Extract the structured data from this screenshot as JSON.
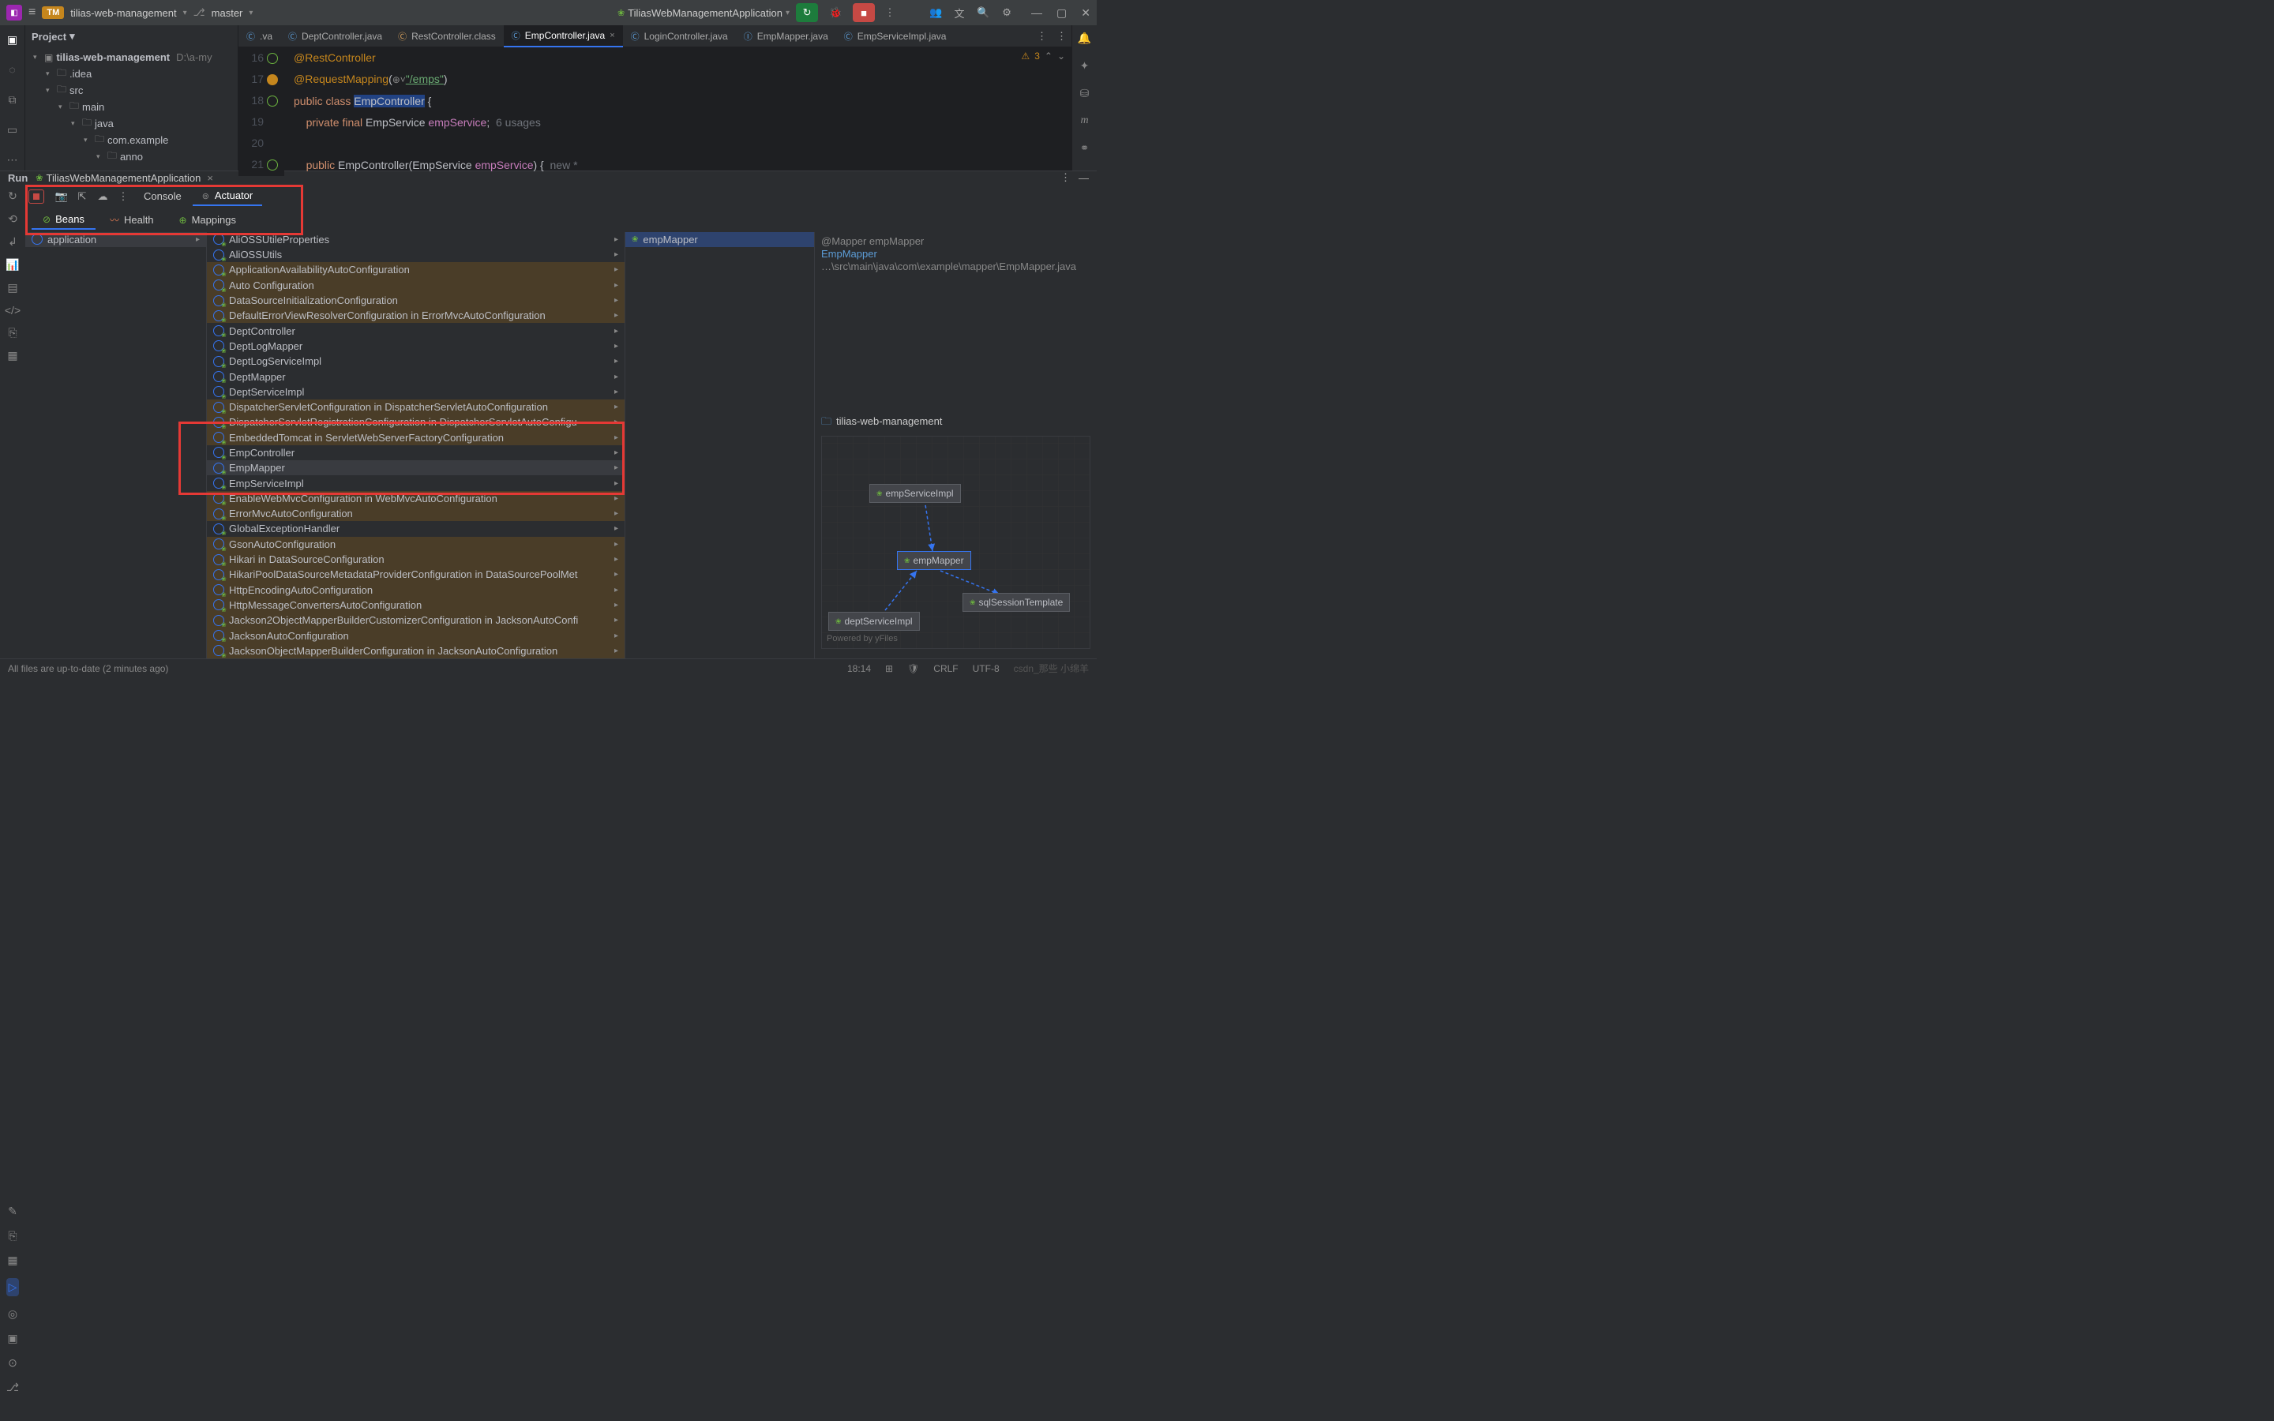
{
  "titlebar": {
    "project": "tilias-web-management",
    "proj_badge": "TM",
    "branch": "master",
    "run_config": "TiliasWebManagementApplication"
  },
  "project_tree": {
    "title": "Project",
    "root": "tilias-web-management",
    "root_path": "D:\\a-my",
    "nodes": [
      {
        "indent": 1,
        "label": ".idea"
      },
      {
        "indent": 1,
        "label": "src"
      },
      {
        "indent": 2,
        "label": "main"
      },
      {
        "indent": 3,
        "label": "java"
      },
      {
        "indent": 4,
        "label": "com.example"
      },
      {
        "indent": 5,
        "label": "anno"
      }
    ]
  },
  "editor_tabs": [
    {
      "label": ".va",
      "type": "java"
    },
    {
      "label": "DeptController.java",
      "type": "java"
    },
    {
      "label": "RestController.class",
      "type": "cls"
    },
    {
      "label": "EmpController.java",
      "type": "java",
      "active": true,
      "closable": true
    },
    {
      "label": "LoginController.java",
      "type": "java"
    },
    {
      "label": "EmpMapper.java",
      "type": "int"
    },
    {
      "label": "EmpServiceImpl.java",
      "type": "java"
    }
  ],
  "code": {
    "lines": [
      {
        "n": 16,
        "gicon": "green",
        "html": "<span class='anno'>@RestController</span>"
      },
      {
        "n": 17,
        "gicon": "yellow",
        "html": "<span class='anno'>@RequestMapping</span>(<span class='icon-inline'>⊕˅</span><span class='str'>\"/emps\"</span>)"
      },
      {
        "n": 18,
        "gicon": "green",
        "html": "<span class='kw'>public class</span> <span class='cls' style='background:#214283'>EmpController</span> {"
      },
      {
        "n": 19,
        "html": "    <span class='kw'>private final</span> <span class='type'>EmpService</span> <span class='field'>empService</span>;  <span class='hint'>6 usages</span>"
      },
      {
        "n": 20,
        "html": ""
      },
      {
        "n": 21,
        "gicon": "green",
        "html": "    <span class='kw'>public</span> <span class='type'>EmpController</span>(<span class='type'>EmpService</span> <span class='field'>empService</span>) {  <span class='hint'>new *</span>"
      }
    ],
    "problems": "3"
  },
  "run": {
    "title": "Run",
    "config": "TiliasWebManagementApplication",
    "subtabs": {
      "console": "Console",
      "actuator": "Actuator"
    },
    "actuator_tabs": {
      "beans": "Beans",
      "health": "Health",
      "mappings": "Mappings"
    },
    "app_item": "application",
    "beans": [
      {
        "label": "AliOSSUtileProperties",
        "dim": false
      },
      {
        "label": "AliOSSUtils",
        "dim": false
      },
      {
        "label": "ApplicationAvailabilityAutoConfiguration",
        "dim": true
      },
      {
        "label": "Auto Configuration",
        "dim": true
      },
      {
        "label": "DataSourceInitializationConfiguration",
        "dim": true
      },
      {
        "label": "DefaultErrorViewResolverConfiguration in ErrorMvcAutoConfiguration",
        "dim": true
      },
      {
        "label": "DeptController",
        "dim": false
      },
      {
        "label": "DeptLogMapper",
        "dim": false
      },
      {
        "label": "DeptLogServiceImpl",
        "dim": false
      },
      {
        "label": "DeptMapper",
        "dim": false
      },
      {
        "label": "DeptServiceImpl",
        "dim": false
      },
      {
        "label": "DispatcherServletConfiguration in DispatcherServletAutoConfiguration",
        "dim": true
      },
      {
        "label": "DispatcherServletRegistrationConfiguration in DispatcherServletAutoConfigu",
        "dim": true
      },
      {
        "label": "EmbeddedTomcat in ServletWebServerFactoryConfiguration",
        "dim": true
      },
      {
        "label": "EmpController",
        "dim": false
      },
      {
        "label": "EmpMapper",
        "dim": false,
        "sel": true
      },
      {
        "label": "EmpServiceImpl",
        "dim": false
      },
      {
        "label": "EnableWebMvcConfiguration in WebMvcAutoConfiguration",
        "dim": true
      },
      {
        "label": "ErrorMvcAutoConfiguration",
        "dim": true
      },
      {
        "label": "GlobalExceptionHandler",
        "dim": false
      },
      {
        "label": "GsonAutoConfiguration",
        "dim": true
      },
      {
        "label": "Hikari in DataSourceConfiguration",
        "dim": true
      },
      {
        "label": "HikariPoolDataSourceMetadataProviderConfiguration in DataSourcePoolMet",
        "dim": true
      },
      {
        "label": "HttpEncodingAutoConfiguration",
        "dim": true
      },
      {
        "label": "HttpMessageConvertersAutoConfiguration",
        "dim": true
      },
      {
        "label": "Jackson2ObjectMapperBuilderCustomizerConfiguration in JacksonAutoConfi",
        "dim": true
      },
      {
        "label": "JacksonAutoConfiguration",
        "dim": true
      },
      {
        "label": "JacksonObjectMapperBuilderConfiguration in JacksonAutoConfiguration",
        "dim": true
      }
    ],
    "selected_bean": "empMapper",
    "detail": {
      "annotation": "@Mapper empMapper",
      "type": "EmpMapper",
      "path": "…\\src\\main\\java\\com\\example\\mapper\\EmpMapper.java"
    },
    "graph": {
      "project": "tilias-web-management",
      "nodes": {
        "n1": "empServiceImpl",
        "n2": "empMapper",
        "n3": "deptServiceImpl",
        "n4": "sqlSessionTemplate"
      },
      "powered": "Powered by yFiles"
    }
  },
  "statusbar": {
    "left": "All files are up-to-date (2 minutes ago)",
    "time": "18:14",
    "crlf": "CRLF",
    "enc": "UTF-8",
    "watermark": "csdn_那些 小绵羊"
  }
}
